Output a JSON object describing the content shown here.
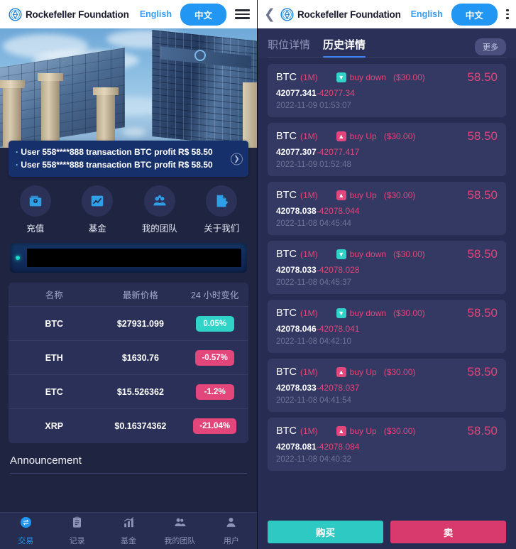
{
  "brand": {
    "name": "Rockefeller Foundation",
    "logo_icon": "diamond-ring-logo-icon"
  },
  "header": {
    "lang_en": "English",
    "lang_zh": "中文",
    "menu_icon": "hamburger-menu-icon",
    "back_icon": "chevron-left-icon",
    "accent_blue": "#2196f3"
  },
  "left": {
    "hero_alt": "office-buildings-photo",
    "marquee": {
      "lines": [
        "User 558****888 transaction BTC profit R$ 58.50",
        "User 558****888 transaction BTC profit R$ 58.50"
      ],
      "arrow_icon": "chevron-right-circle-icon"
    },
    "quickmenu": [
      {
        "label": "充值",
        "icon": "wallet-icon"
      },
      {
        "label": "基金",
        "icon": "chart-up-icon"
      },
      {
        "label": "我的团队",
        "icon": "users-group-icon"
      },
      {
        "label": "关于我们",
        "icon": "document-pencil-icon"
      }
    ],
    "ticker_banner": {
      "dot_icon": "status-dot-icon",
      "text": ""
    },
    "price_table": {
      "headers": [
        "名称",
        "最新价格",
        "24 小时变化"
      ],
      "rows": [
        {
          "symbol": "BTC",
          "price": "$27931.099",
          "change": "0.05%",
          "direction": "up"
        },
        {
          "symbol": "ETH",
          "price": "$1630.76",
          "change": "-0.57%",
          "direction": "down"
        },
        {
          "symbol": "ETC",
          "price": "$15.526362",
          "change": "-1.2%",
          "direction": "down"
        },
        {
          "symbol": "XRP",
          "price": "$0.16374362",
          "change": "-21.04%",
          "direction": "down"
        }
      ]
    },
    "announcement": {
      "title": "Announcement"
    },
    "bottom_nav": [
      {
        "label": "交易",
        "icon": "exchange-icon",
        "active": true
      },
      {
        "label": "记录",
        "icon": "clipboard-icon",
        "active": false
      },
      {
        "label": "基金",
        "icon": "bar-chart-icon",
        "active": false
      },
      {
        "label": "我的团队",
        "icon": "users-icon",
        "active": false
      },
      {
        "label": "用户",
        "icon": "user-icon",
        "active": false
      }
    ]
  },
  "right": {
    "tabs": [
      {
        "label": "职位详情",
        "active": false
      },
      {
        "label": "历史详情",
        "active": true
      }
    ],
    "more_label": "更多",
    "orders": [
      {
        "symbol": "BTC",
        "period": "(1M)",
        "direction": "buy down",
        "dir_icon": "arrow-down-box-icon",
        "amount": "($30.00)",
        "value": "58.50",
        "open": "42077.341",
        "close": "42077.34",
        "time": "2022-11-09 01:53:07"
      },
      {
        "symbol": "BTC",
        "period": "(1M)",
        "direction": "buy Up",
        "dir_icon": "arrow-up-box-icon",
        "amount": "($30.00)",
        "value": "58.50",
        "open": "42077.307",
        "close": "42077.417",
        "time": "2022-11-09 01:52:48"
      },
      {
        "symbol": "BTC",
        "period": "(1M)",
        "direction": "buy Up",
        "dir_icon": "arrow-up-box-icon",
        "amount": "($30.00)",
        "value": "58.50",
        "open": "42078.038",
        "close": "42078.044",
        "time": "2022-11-08 04:45:44"
      },
      {
        "symbol": "BTC",
        "period": "(1M)",
        "direction": "buy down",
        "dir_icon": "arrow-down-box-icon",
        "amount": "($30.00)",
        "value": "58.50",
        "open": "42078.033",
        "close": "42078.028",
        "time": "2022-11-08 04:45:37"
      },
      {
        "symbol": "BTC",
        "period": "(1M)",
        "direction": "buy down",
        "dir_icon": "arrow-down-box-icon",
        "amount": "($30.00)",
        "value": "58.50",
        "open": "42078.046",
        "close": "42078.041",
        "time": "2022-11-08 04:42:10"
      },
      {
        "symbol": "BTC",
        "period": "(1M)",
        "direction": "buy Up",
        "dir_icon": "arrow-up-box-icon",
        "amount": "($30.00)",
        "value": "58.50",
        "open": "42078.033",
        "close": "42078.037",
        "time": "2022-11-08 04:41:54"
      },
      {
        "symbol": "BTC",
        "period": "(1M)",
        "direction": "buy Up",
        "dir_icon": "arrow-up-box-icon",
        "amount": "($30.00)",
        "value": "58.50",
        "open": "42078.081",
        "close": "42078.084",
        "time": "2022-11-08 04:40:32"
      }
    ],
    "buy_label": "购买",
    "sell_label": "卖",
    "colors": {
      "up": "#e2467a",
      "down": "#2fd3c8",
      "buy_btn": "#2fc9c4",
      "sell_btn": "#d93a6e"
    }
  }
}
